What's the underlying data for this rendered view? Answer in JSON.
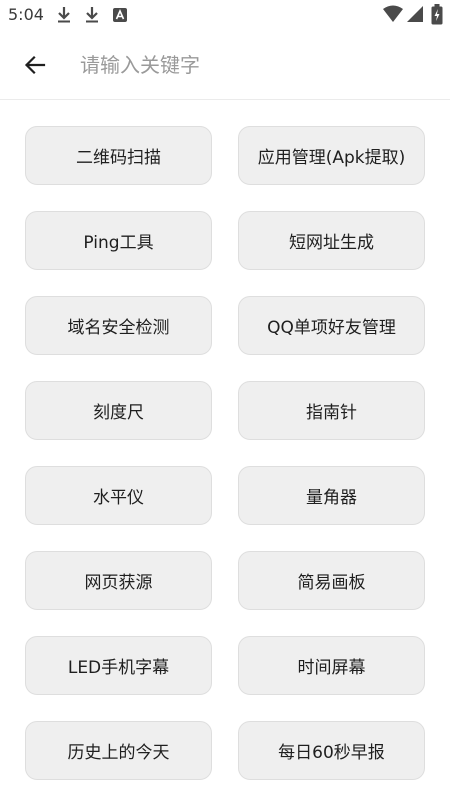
{
  "status_bar": {
    "time": "5:04",
    "icons": [
      "download-icon",
      "download-icon",
      "accessibility-a-icon",
      "wifi-icon",
      "signal-icon",
      "battery-charging-icon"
    ]
  },
  "header": {
    "back_icon": "arrow-left-icon",
    "search_placeholder": "请输入关键字",
    "search_value": ""
  },
  "tools": [
    "二维码扫描",
    "应用管理(Apk提取)",
    "Ping工具",
    "短网址生成",
    "域名安全检测",
    "QQ单项好友管理",
    "刻度尺",
    "指南针",
    "水平仪",
    "量角器",
    "网页获源",
    "简易画板",
    "LED手机字幕",
    "时间屏幕",
    "历史上的今天",
    "每日60秒早报"
  ]
}
